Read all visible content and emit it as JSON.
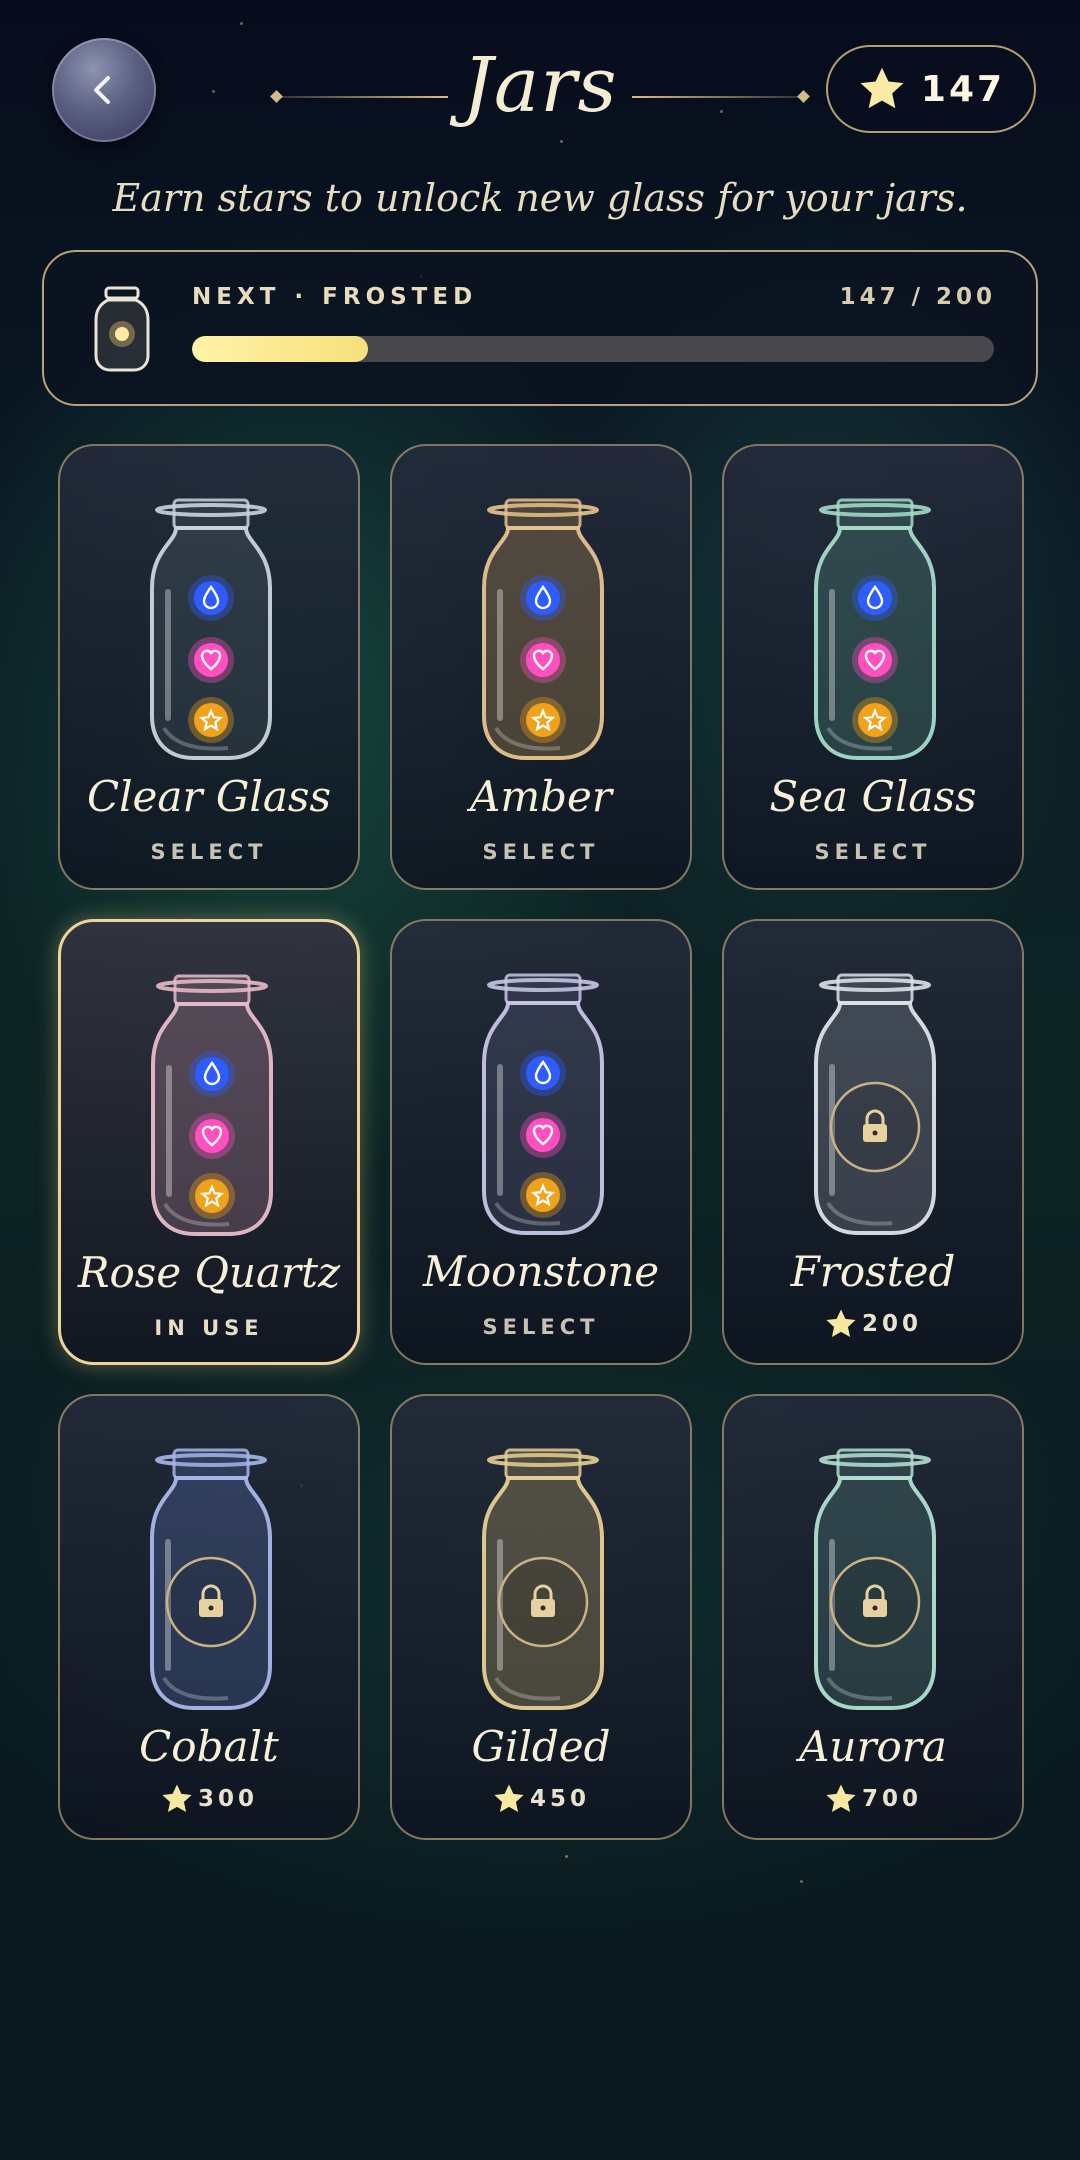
{
  "header": {
    "back_icon": "chevron-left-icon",
    "title": "Jars",
    "star_icon": "star-icon",
    "star_count": "147"
  },
  "subtitle": "Earn stars to unlock new glass for your jars.",
  "progress": {
    "icon": "jar-icon",
    "next_prefix": "NEXT",
    "separator": "·",
    "next_name": "FROSTED",
    "count_text": "147 / 200",
    "fraction": 0.22
  },
  "colors": {
    "gold_border": "#b7a27a",
    "active_border": "#ecd49a",
    "progress_fill": "#f6e07a",
    "star": "#f6e8a0",
    "drop_blue": "#2f5cff",
    "heart_pink": "#ff4fc0",
    "star_orange": "#f0a21a"
  },
  "jars": [
    {
      "name": "Clear Glass",
      "state": "select",
      "status": "SELECT",
      "glass": "#c9d4dc",
      "tint": "rgba(200,215,225,0.10)",
      "unlocked": true
    },
    {
      "name": "Amber",
      "state": "select",
      "status": "SELECT",
      "glass": "#e7c490",
      "tint": "rgba(210,160,90,0.30)",
      "unlocked": true
    },
    {
      "name": "Sea Glass",
      "state": "select",
      "status": "SELECT",
      "glass": "#a6dcc8",
      "tint": "rgba(120,200,170,0.22)",
      "unlocked": true
    },
    {
      "name": "Rose Quartz",
      "state": "in-use",
      "status": "IN USE",
      "glass": "#e8bccb",
      "tint": "rgba(220,160,180,0.25)",
      "unlocked": true
    },
    {
      "name": "Moonstone",
      "state": "select",
      "status": "SELECT",
      "glass": "#c9c6e6",
      "tint": "rgba(160,160,210,0.16)",
      "unlocked": true
    },
    {
      "name": "Frosted",
      "state": "locked",
      "price": "200",
      "glass": "#dfe3e8",
      "tint": "rgba(200,205,215,0.22)",
      "unlocked": false
    },
    {
      "name": "Cobalt",
      "state": "locked",
      "price": "300",
      "glass": "#a9b8e8",
      "tint": "rgba(110,140,220,0.25)",
      "unlocked": false
    },
    {
      "name": "Gilded",
      "state": "locked",
      "price": "450",
      "glass": "#e8cf94",
      "tint": "rgba(210,180,110,0.30)",
      "unlocked": false
    },
    {
      "name": "Aurora",
      "state": "locked",
      "price": "700",
      "glass": "#b3e0cf",
      "tint": "rgba(130,200,180,0.20)",
      "unlocked": false
    }
  ],
  "icons": {
    "drop": "water-drop-icon",
    "heart": "heart-icon",
    "star": "star-icon",
    "lock": "lock-icon"
  }
}
